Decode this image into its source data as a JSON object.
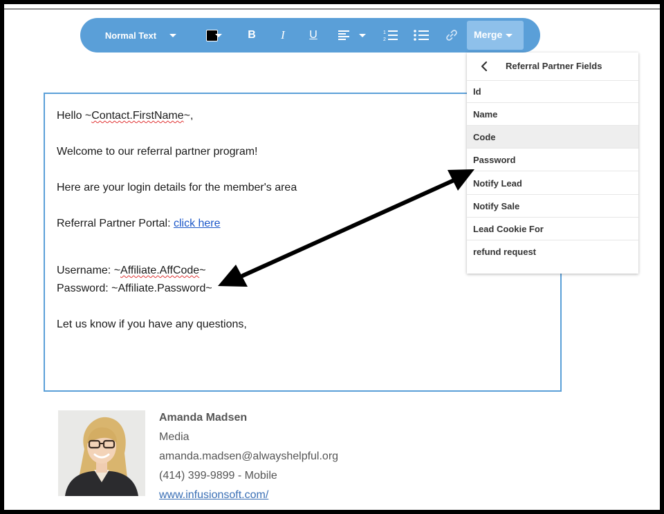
{
  "toolbar": {
    "text_style": "Normal Text",
    "text_color": "#000000",
    "bold": "B",
    "italic": "I",
    "underline": "U",
    "merge_label": "Merge"
  },
  "editor": {
    "greeting_prefix": "Hello ~",
    "greeting_field": "Contact.FirstName",
    "greeting_suffix": "~,",
    "welcome": "Welcome to our referral partner program!",
    "login_intro": "Here are your login details for the member's area",
    "portal_label": "Referral Partner Portal: ",
    "portal_link": "click here",
    "username_prefix": "Username: ~",
    "username_field": "Affiliate.AffCode",
    "username_suffix": "~",
    "password_line": "Password: ~Affiliate.Password~",
    "closing": "Let us know if you have any questions,"
  },
  "merge_menu": {
    "title": "Referral Partner Fields",
    "highlighted_item": "Code",
    "items": [
      "Id",
      "Name",
      "Code",
      "Password",
      "Notify Lead",
      "Notify Sale",
      "Lead Cookie For",
      "refund request"
    ]
  },
  "signature": {
    "name": "Amanda Madsen",
    "title": "Media",
    "email": "amanda.madsen@alwayshelpful.org",
    "phone": "(414) 399-9899 - Mobile",
    "website": "www.infusionsoft.com/"
  },
  "colors": {
    "toolbar_bg": "#5a9fd8",
    "merge_active_bg": "#8ec0ea",
    "editor_border": "#5a9fd8",
    "link": "#1a56c8",
    "highlight_row": "#eeeeee"
  }
}
